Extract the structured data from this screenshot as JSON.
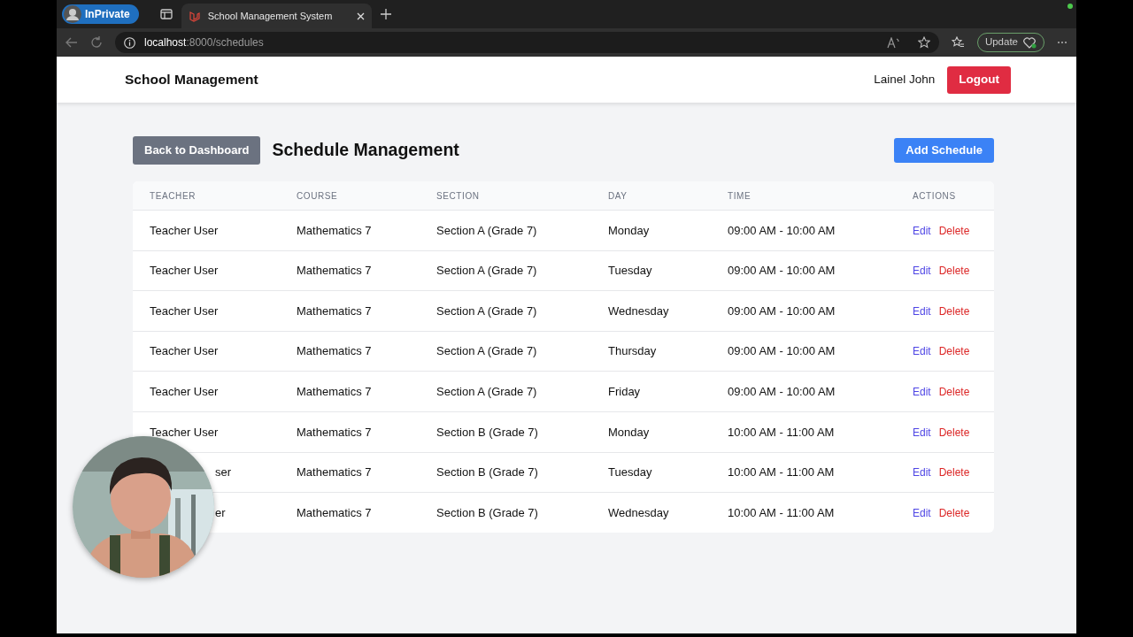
{
  "browser": {
    "profile": "InPrivate",
    "tab_title": "School Management System",
    "url_host": "localhost",
    "url_path": ":8000/schedules",
    "update_label": "Update"
  },
  "navbar": {
    "brand": "School Management",
    "user": "Lainel John",
    "logout": "Logout"
  },
  "header": {
    "back": "Back to Dashboard",
    "title": "Schedule Management",
    "add": "Add Schedule"
  },
  "table": {
    "columns": [
      "TEACHER",
      "COURSE",
      "SECTION",
      "DAY",
      "TIME",
      "ACTIONS"
    ],
    "rows": [
      {
        "teacher": "Teacher User",
        "course": "Mathematics 7",
        "section": "Section A (Grade 7)",
        "day": "Monday",
        "time": "09:00 AM - 10:00 AM",
        "actions": [
          "Edit",
          "Delete"
        ]
      },
      {
        "teacher": "Teacher User",
        "course": "Mathematics 7",
        "section": "Section A (Grade 7)",
        "day": "Tuesday",
        "time": "09:00 AM - 10:00 AM",
        "actions": [
          "Edit",
          "Delete"
        ]
      },
      {
        "teacher": "Teacher User",
        "course": "Mathematics 7",
        "section": "Section A (Grade 7)",
        "day": "Wednesday",
        "time": "09:00 AM - 10:00 AM",
        "actions": [
          "Edit",
          "Delete"
        ]
      },
      {
        "teacher": "Teacher User",
        "course": "Mathematics 7",
        "section": "Section A (Grade 7)",
        "day": "Thursday",
        "time": "09:00 AM - 10:00 AM",
        "actions": [
          "Edit",
          "Delete"
        ]
      },
      {
        "teacher": "Teacher User",
        "course": "Mathematics 7",
        "section": "Section A (Grade 7)",
        "day": "Friday",
        "time": "09:00 AM - 10:00 AM",
        "actions": [
          "Edit",
          "Delete"
        ]
      },
      {
        "teacher": "Teacher User",
        "course": "Mathematics 7",
        "section": "Section B (Grade 7)",
        "day": "Monday",
        "time": "10:00 AM - 11:00 AM",
        "actions": [
          "Edit",
          "Delete"
        ]
      },
      {
        "teacher": "ser",
        "course": "Mathematics 7",
        "section": "Section B (Grade 7)",
        "day": "Tuesday",
        "time": "10:00 AM - 11:00 AM",
        "actions": [
          "Edit",
          "Delete"
        ],
        "partly_covered": true
      },
      {
        "teacher": "er",
        "course": "Mathematics 7",
        "section": "Section B (Grade 7)",
        "day": "Wednesday",
        "time": "10:00 AM - 11:00 AM",
        "actions": [
          "Edit",
          "Delete"
        ],
        "partly_covered": true
      }
    ]
  }
}
